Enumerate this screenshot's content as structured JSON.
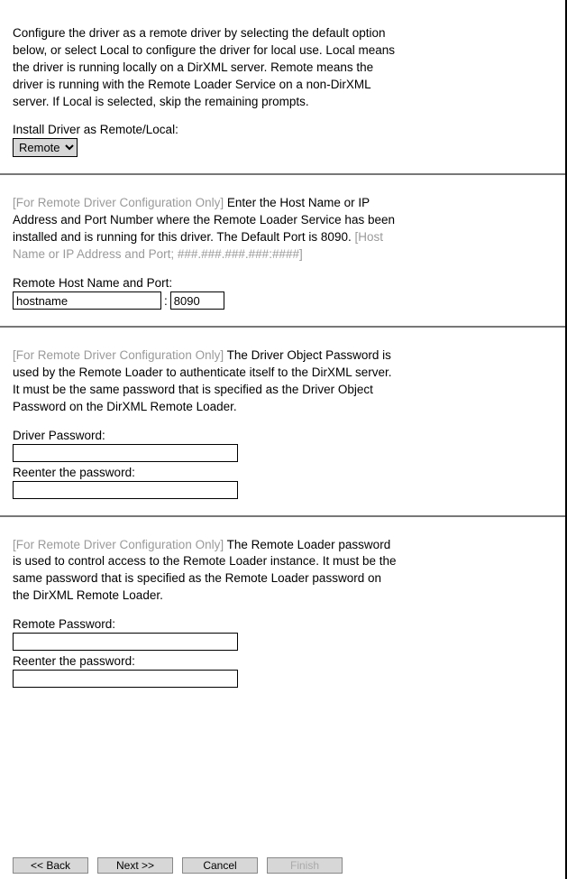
{
  "s1": {
    "desc": "Configure the driver as a remote driver by selecting the default option below, or select Local to configure the driver for local use.  Local means the driver is running locally on a DirXML server.  Remote means the driver is running with the Remote Loader Service on a non-DirXML server.  If Local is selected, skip the remaining prompts.",
    "label": "Install Driver as Remote/Local:",
    "option": "Remote"
  },
  "s2": {
    "prefix": "[For Remote Driver Configuration Only]",
    "body": " Enter the Host Name or IP Address and Port Number where the Remote Loader Service has been installed and is running for this driver. The Default Port is 8090. ",
    "suffix": "[Host Name or IP Address and Port; ###.###.###.###:####]",
    "label": "Remote Host Name and Port:",
    "host": "hostname",
    "colon": ":",
    "port": "8090"
  },
  "s3": {
    "prefix": "[For Remote Driver Configuration Only]",
    "body": " The Driver Object Password is used by the Remote Loader to authenticate itself to the DirXML server.  It must be the same password that is specified as the Driver Object Password on the DirXML Remote Loader.",
    "label1": "Driver Password:",
    "label2": "Reenter the password:"
  },
  "s4": {
    "prefix": "[For Remote Driver Configuration Only]",
    "body": " The Remote Loader password is used to control access to the Remote Loader instance.  It must be the same password that is specified as the Remote Loader password on the DirXML Remote Loader.",
    "label1": "Remote Password:",
    "label2": "Reenter the password:"
  },
  "buttons": {
    "back": "<<  Back",
    "next": "Next  >>",
    "cancel": "Cancel",
    "finish": "Finish"
  }
}
